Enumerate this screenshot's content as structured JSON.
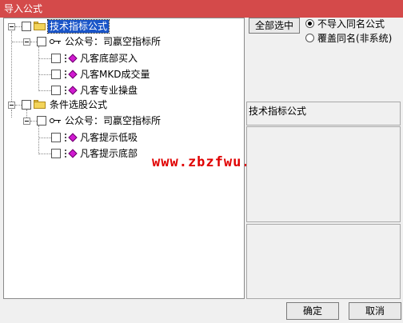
{
  "window": {
    "title": "导入公式"
  },
  "tree": {
    "root1": {
      "label": "技术指标公式"
    },
    "root1_group": {
      "label": "公众号：司嬴空指标所"
    },
    "root1_items": [
      "凡客底部买入",
      "凡客MKD成交量",
      "凡客专业操盘"
    ],
    "root2": {
      "label": "条件选股公式"
    },
    "root2_group": {
      "label": "公众号：司嬴空指标所"
    },
    "root2_items": [
      "凡客提示低吸",
      "凡客提示底部"
    ]
  },
  "options": {
    "select_all_label": "全部选中",
    "radio_skip_label": "不导入同名公式",
    "radio_overwrite_label": "覆盖同名(非系统)",
    "selected": "skip"
  },
  "info": {
    "panel_title": "技术指标公式"
  },
  "watermark": "www.zbzfwu.com",
  "buttons": {
    "ok_label": "确定",
    "cancel_label": "取消"
  }
}
